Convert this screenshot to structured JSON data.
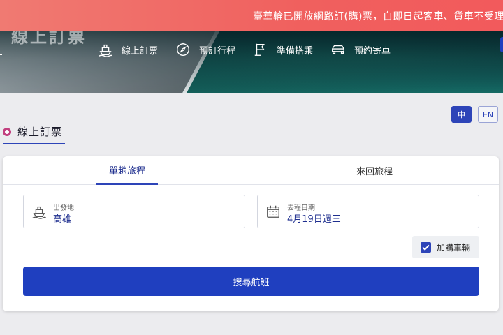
{
  "banner": {
    "text": "臺華輪已開放網路訂(購)票，自即日起客車、貨車不受理現場售"
  },
  "hero": {
    "title": "線上訂票"
  },
  "nav": {
    "items": [
      {
        "label": "線上訂票",
        "icon": "ship-icon"
      },
      {
        "label": "預訂行程",
        "icon": "compass-icon"
      },
      {
        "label": "準備搭乘",
        "icon": "flag-icon"
      },
      {
        "label": "預約寄車",
        "icon": "car-icon"
      }
    ]
  },
  "lang": {
    "zh": "中",
    "en": "EN"
  },
  "section": {
    "title": "線上訂票"
  },
  "booking": {
    "tabs": [
      {
        "label": "單趟旅程",
        "active": true
      },
      {
        "label": "來回旅程",
        "active": false
      }
    ],
    "origin": {
      "label": "出發地",
      "value": "高雄"
    },
    "date": {
      "label": "去程日期",
      "value": "4月19日週三"
    },
    "add_vehicle": {
      "label": "加購車輛",
      "checked": true
    },
    "search_label": "搜尋航班"
  },
  "colors": {
    "banner": "#f0605e",
    "primary": "#1f3fbf",
    "accent_dot": "#c2407f"
  }
}
